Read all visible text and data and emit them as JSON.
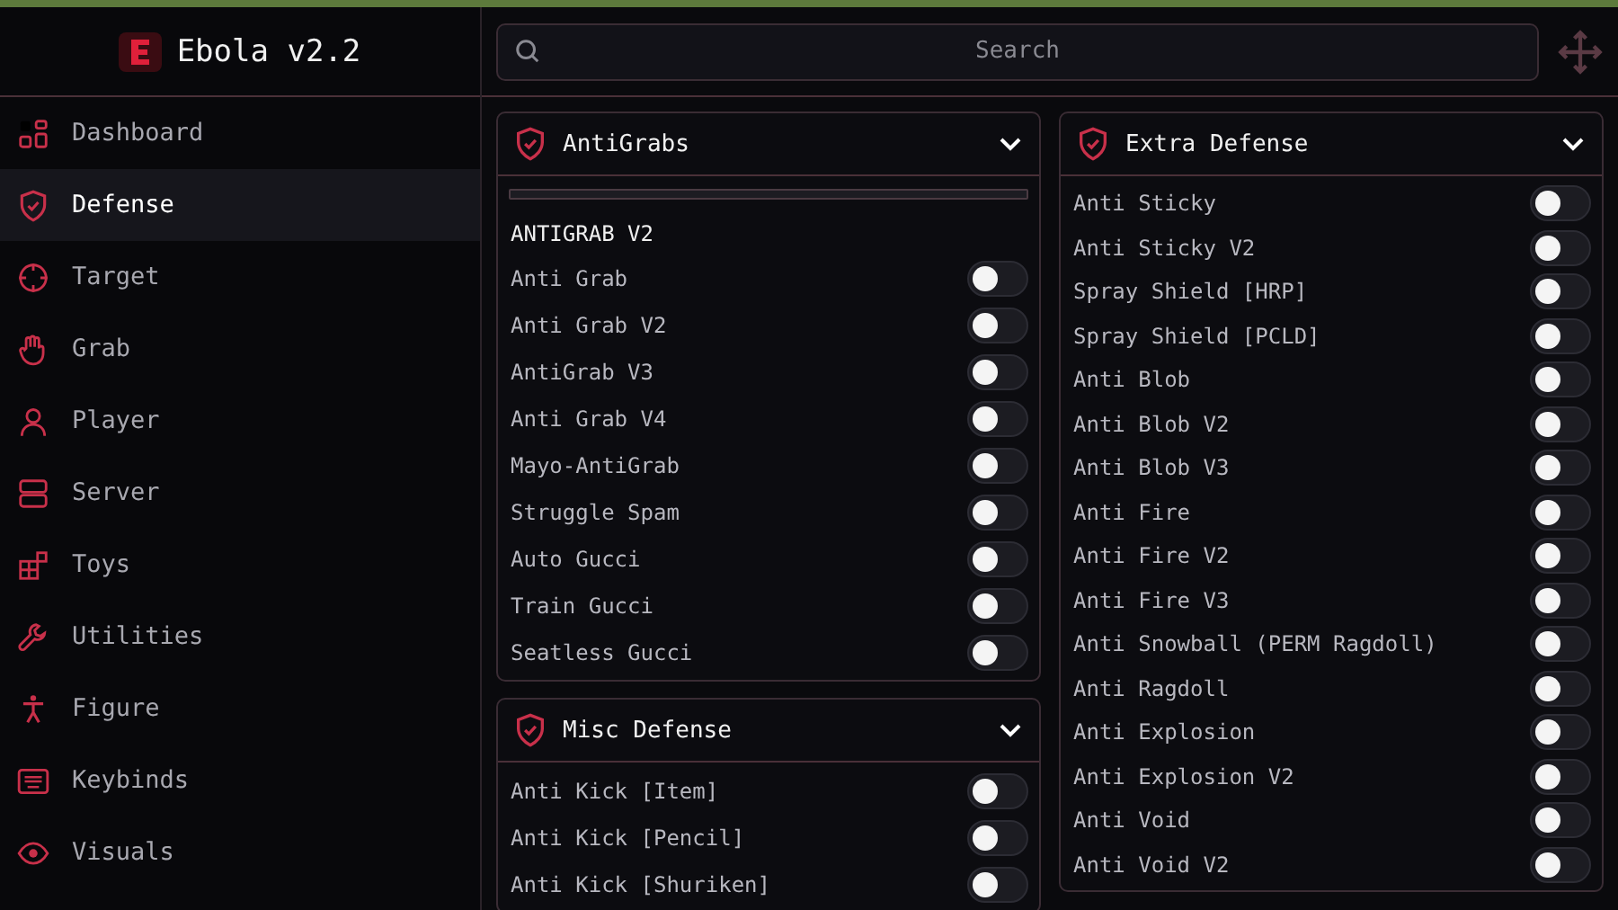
{
  "app": {
    "title": "Ebola v2.2"
  },
  "sidebar": {
    "items": [
      {
        "label": "Dashboard",
        "selected": false
      },
      {
        "label": "Defense",
        "selected": true
      },
      {
        "label": "Target",
        "selected": false
      },
      {
        "label": "Grab",
        "selected": false
      },
      {
        "label": "Player",
        "selected": false
      },
      {
        "label": "Server",
        "selected": false
      },
      {
        "label": "Toys",
        "selected": false
      },
      {
        "label": "Utilities",
        "selected": false
      },
      {
        "label": "Figure",
        "selected": false
      },
      {
        "label": "Keybinds",
        "selected": false
      },
      {
        "label": "Visuals",
        "selected": false
      }
    ]
  },
  "search": {
    "placeholder": "Search"
  },
  "columns": [
    [
      {
        "title": "AntiGrabs",
        "expanded": true,
        "subheading": "ANTIGRAB V2",
        "toggles": [
          {
            "label": "Anti Grab",
            "on": false
          },
          {
            "label": "Anti Grab V2",
            "on": false
          },
          {
            "label": "AntiGrab V3",
            "on": false
          },
          {
            "label": "Anti Grab V4",
            "on": false
          },
          {
            "label": "Mayo-AntiGrab",
            "on": false
          },
          {
            "label": "Struggle Spam",
            "on": false
          },
          {
            "label": "Auto Gucci",
            "on": false
          },
          {
            "label": "Train Gucci",
            "on": false
          },
          {
            "label": "Seatless Gucci",
            "on": false
          }
        ]
      },
      {
        "title": "Misc Defense",
        "expanded": true,
        "toggles": [
          {
            "label": "Anti Kick [Item]",
            "on": false
          },
          {
            "label": "Anti Kick [Pencil]",
            "on": false
          },
          {
            "label": "Anti Kick [Shuriken]",
            "on": false
          }
        ]
      }
    ],
    [
      {
        "title": "Extra Defense",
        "expanded": true,
        "toggles": [
          {
            "label": "Anti Sticky",
            "on": false
          },
          {
            "label": "Anti Sticky V2",
            "on": false
          },
          {
            "label": "Spray Shield [HRP]",
            "on": false
          },
          {
            "label": "Spray Shield [PCLD]",
            "on": false
          },
          {
            "label": "Anti Blob",
            "on": false
          },
          {
            "label": "Anti Blob V2",
            "on": false
          },
          {
            "label": "Anti Blob V3",
            "on": false
          },
          {
            "label": "Anti Fire",
            "on": false
          },
          {
            "label": "Anti Fire V2",
            "on": false
          },
          {
            "label": "Anti Fire V3",
            "on": false
          },
          {
            "label": "Anti Snowball (PERM Ragdoll)",
            "on": false
          },
          {
            "label": "Anti Ragdoll",
            "on": false
          },
          {
            "label": "Anti Explosion",
            "on": false
          },
          {
            "label": "Anti Explosion V2",
            "on": false
          },
          {
            "label": "Anti Void",
            "on": false
          },
          {
            "label": "Anti Void V2",
            "on": false
          }
        ]
      }
    ]
  ]
}
